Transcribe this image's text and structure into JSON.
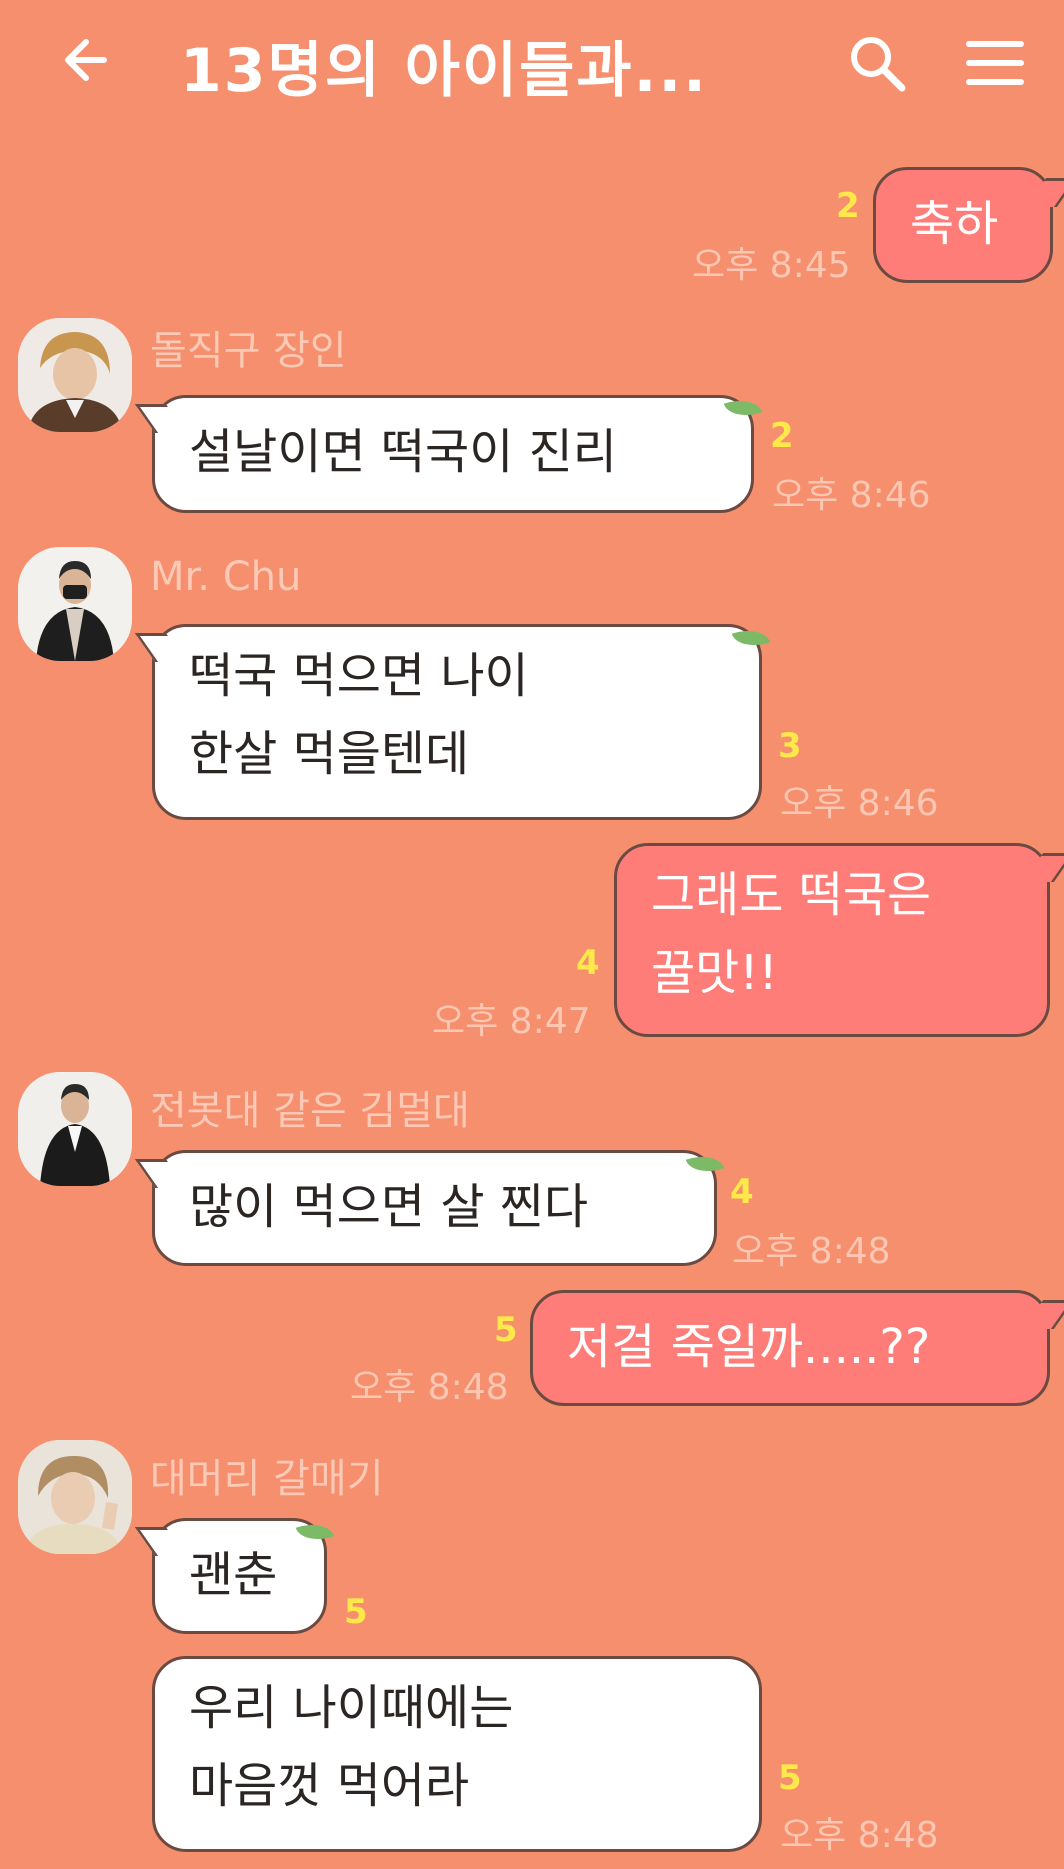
{
  "header": {
    "title": "13명의 아이들과...",
    "back_icon": "arrow-left-icon",
    "search_icon": "search-icon",
    "menu_icon": "hamburger-menu-icon"
  },
  "colors": {
    "background": "#F58F6E",
    "incoming_bubble": "#FFFFFF",
    "outgoing_bubble": "#FF7D78",
    "unread_count": "#FFE84A",
    "sender_name": "#FBC9B5"
  },
  "messages": [
    {
      "direction": "out",
      "text": "축하",
      "unread": "2",
      "time": "오후 8:45"
    },
    {
      "direction": "in",
      "sender": "돌직구 장인",
      "text": "설날이면 떡국이 진리",
      "unread": "2",
      "time": "오후 8:46"
    },
    {
      "direction": "in",
      "sender": "Mr. Chu",
      "line1": "떡국 먹으면 나이",
      "line2": "한살 먹을텐데",
      "unread": "3",
      "time": "오후 8:46"
    },
    {
      "direction": "out",
      "line1": "그래도 떡국은",
      "line2": "꿀맛!!",
      "unread": "4",
      "time": "오후 8:47"
    },
    {
      "direction": "in",
      "sender": "전봇대 같은 김멀대",
      "text": "많이 먹으면 살 찐다",
      "unread": "4",
      "time": "오후 8:48"
    },
    {
      "direction": "out",
      "text": "저걸 죽일까.....??",
      "unread": "5",
      "time": "오후 8:48"
    },
    {
      "direction": "in",
      "sender": "대머리 갈매기",
      "text": "괜춘",
      "unread": "5"
    },
    {
      "direction": "in",
      "line1": "우리 나이때에는",
      "line2": "마음껏 먹어라",
      "unread": "5",
      "time": "오후 8:48"
    }
  ]
}
